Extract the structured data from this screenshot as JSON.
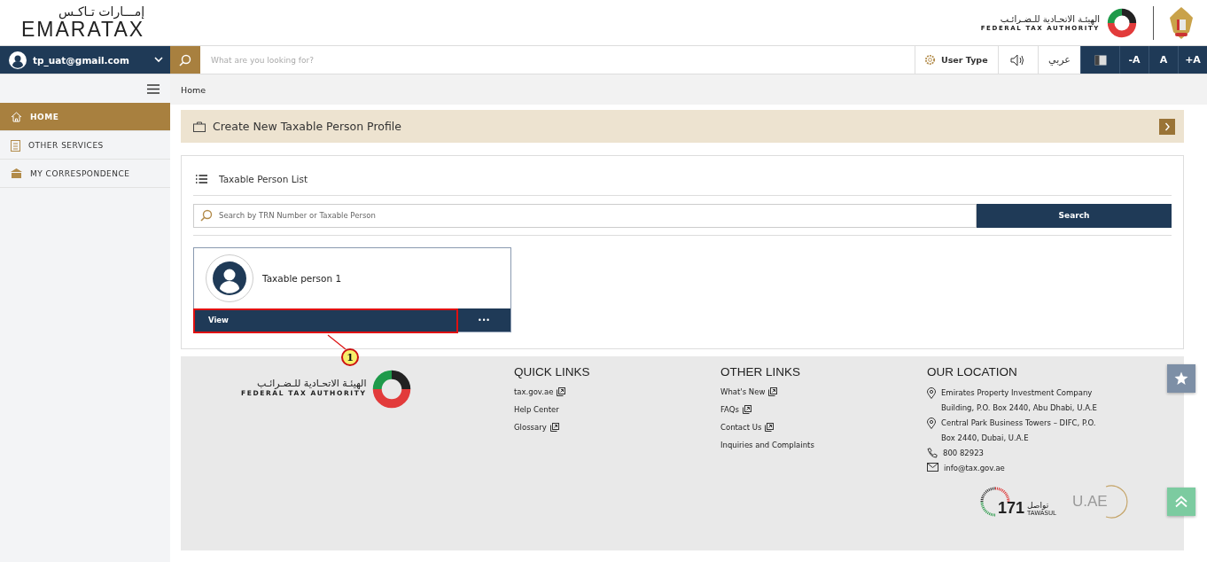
{
  "header": {
    "logo_arabic": "إمـــارات تـاكـس",
    "logo_text": "EMARATAX",
    "authority_arabic": "الهيئـة الاتحـادية للـضـرائـب",
    "authority_name": "FEDERAL TAX AUTHORITY"
  },
  "topbar": {
    "user": "tp_uat@gmail.com",
    "search": {
      "placeholder": "What are you looking for?"
    },
    "user_type": "User Type",
    "language": "عربي",
    "font_buttons": [
      "-A",
      "A",
      "+A"
    ]
  },
  "sidebar": {
    "items": [
      {
        "label": "HOME",
        "kind": "home",
        "selected": true
      },
      {
        "label": "OTHER SERVICES",
        "kind": "clipboard",
        "selected": false
      },
      {
        "label": "MY CORRESPONDENCE",
        "kind": "building",
        "selected": false
      }
    ]
  },
  "breadcrumb": "Home",
  "create_banner": {
    "label": "Create New Taxable Person Profile"
  },
  "person_list": {
    "title": "Taxable Person List",
    "search": {
      "placeholder": "Search by TRN Number or Taxable Person",
      "button": "Search"
    },
    "persons": [
      {
        "name": "Taxable person 1",
        "action": "View",
        "more": "•••"
      }
    ]
  },
  "annotation": {
    "number": "1"
  },
  "footer": {
    "authority_arabic": "الهيئـة الاتحـادية للـضـرائـب",
    "authority_name": "FEDERAL TAX AUTHORITY",
    "quick_links": {
      "title": "QUICK LINKS",
      "links": [
        {
          "label": "tax.gov.ae",
          "external": true
        },
        {
          "label": "Help Center",
          "external": false
        },
        {
          "label": "Glossary",
          "external": true
        }
      ]
    },
    "other_links": {
      "title": "OTHER LINKS",
      "links": [
        {
          "label": "What's New",
          "external": true
        },
        {
          "label": "FAQs",
          "external": true
        },
        {
          "label": "Contact Us",
          "external": true
        },
        {
          "label": "Inquiries and Complaints",
          "external": false
        }
      ]
    },
    "location": {
      "title": "OUR LOCATION",
      "items": [
        {
          "kind": "pin",
          "lines": [
            "Emirates Property Investment Company",
            "Building, P.O. Box 2440, Abu Dhabi, U.A.E"
          ]
        },
        {
          "kind": "pin",
          "lines": [
            "Central Park Business Towers – DIFC, P.O.",
            "Box 2440, Dubai, U.A.E"
          ]
        },
        {
          "kind": "phone",
          "lines": [
            "800 82923"
          ]
        },
        {
          "kind": "mail",
          "lines": [
            "info@tax.gov.ae"
          ]
        }
      ]
    },
    "logos": {
      "tawasul_number": "171",
      "tawasul_arabic": "تواصل",
      "tawasul_name": "TAWASUL",
      "uae": "U.AE"
    }
  }
}
